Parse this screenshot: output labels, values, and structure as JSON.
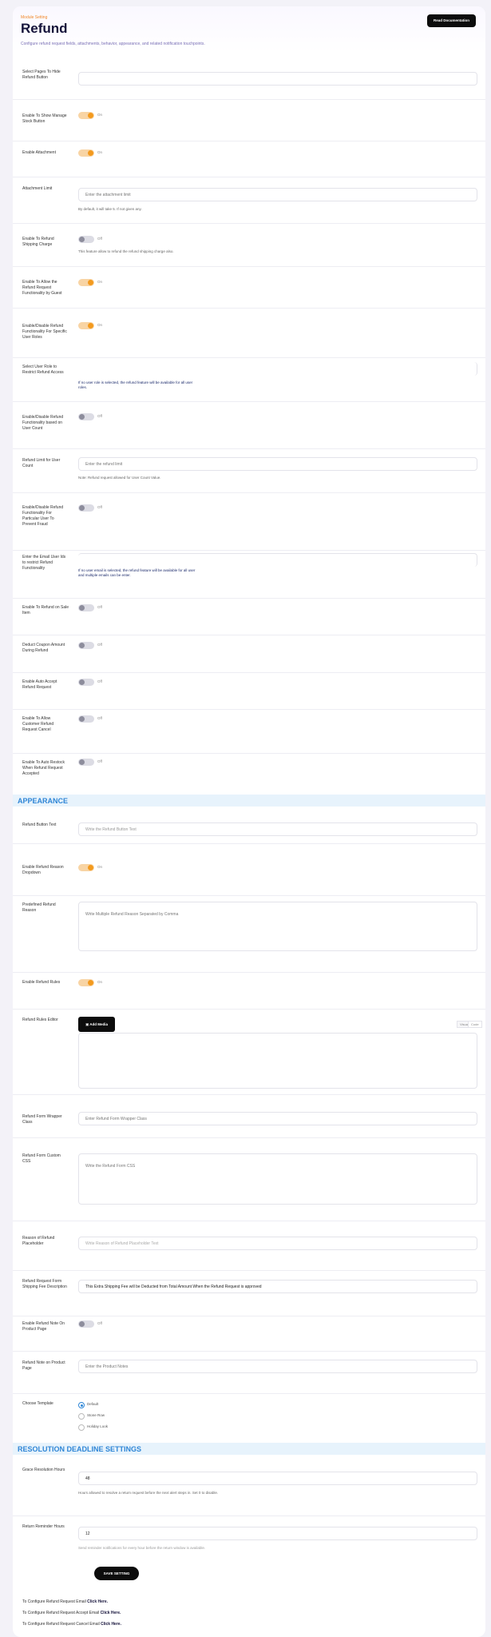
{
  "header": {
    "breadcrumb": "Module Setting",
    "title": "Refund",
    "subtitle": "Configure refund request fields, attachments, behavior, appearance, and related notification touchpoints.",
    "doc_button": "Read Documentation"
  },
  "fields": {
    "select_pages": {
      "label": "Select Pages To Hide Refund Button",
      "value": ""
    },
    "manage_stock": {
      "label": "Enable To Show Manage Stock Button",
      "state": "On"
    },
    "attachment": {
      "label": "Enable Attachment",
      "state": "On"
    },
    "attachment_limit": {
      "label": "Attachment Limit",
      "placeholder": "Enter the attachment limit",
      "desc": "By default, it will take 5. If not given any."
    },
    "shipping_charge": {
      "label": "Enable To Refund Shipping Charge",
      "state": "Off",
      "desc": "This feature allow to refund the refund shipping charge also."
    },
    "guest_user": {
      "label": "Enable To Allow the Refund Request Functionality by Guest",
      "state": "On"
    },
    "specific_user": {
      "label": "Enable/Disable Refund Functionality For Specific User Roles",
      "state": "On"
    },
    "user_roles": {
      "label": "Select User Role to Restrict Refund Access",
      "desc": "If no user role is selected, the refund feature will be available for all user roles."
    },
    "user_count": {
      "label": "Enable/Disable Refund Functionality based on User Count",
      "state": "Off"
    },
    "refund_limit": {
      "label": "Refund Limit for User Count",
      "placeholder": "Enter the refund limit",
      "desc": "Note: Refund request allowed for User Count Value."
    },
    "particular_user": {
      "label": "Enable/Disable Refund Functionality For Particular User To Prevent Fraud",
      "state": "Off"
    },
    "restrict_emails": {
      "label": "Enter the Email User Ids to restrict Refund Functionality",
      "desc": "If no user email is selected, the refund feature will be available for all user and multiple emails can be enter."
    },
    "refund_sale": {
      "label": "Enable To Refund on Sale Item",
      "state": "Off"
    },
    "coupon_amount": {
      "label": "Deduct Coupon Amount During Refund",
      "state": "Off"
    },
    "auto_accept": {
      "label": "Enable Auto Accept Refund Request",
      "state": "Off"
    },
    "customer_cancel": {
      "label": "Enable To Allow Customer Refund Request Cancel",
      "state": "Off"
    },
    "auto_restock": {
      "label": "Enable To Auto Restock When Refund Request Accepted",
      "state": "Off"
    }
  },
  "appearance": {
    "section_title": "APPEARANCE",
    "button_text": {
      "label": "Refund Button Text",
      "placeholder": "Write the Refund Button Text"
    },
    "reasons_toggle": {
      "label": "Enable Refund Reason Dropdown",
      "state": "On"
    },
    "reasons": {
      "label": "Predefined Refund Reason",
      "placeholder": "Write Multiple Refund Reason Separated by Comma"
    },
    "rules_toggle": {
      "label": "Enable Refund Rules",
      "state": "On"
    },
    "rules_editor": {
      "label": "Refund Rules Editor",
      "add_media": "Add Media",
      "tab_visual": "Visual",
      "tab_code": "Code"
    },
    "wrapper_class": {
      "label": "Refund Form Wrapper Class",
      "placeholder": "Enter Refund Form Wrapper Class"
    },
    "custom_css": {
      "label": "Refund Form Custom CSS",
      "placeholder": "Write the Refund Form CSS"
    },
    "reason_placeholder": {
      "label": "Reason of Refund Placeholder",
      "placeholder": "Write Reason of Refund Placeholder Text"
    },
    "shipping_fee_desc": {
      "label": "Refund Request Form Shipping Fee Description",
      "value": "This Extra Shipping Fee will be Deducted from Total Amount When the Refund Request is approved"
    },
    "product_page": {
      "label": "Enable Refund Note On Product Page",
      "state": "Off"
    },
    "product_note": {
      "label": "Refund Note on Product Page",
      "placeholder": "Enter the Product Notes"
    },
    "templates": {
      "label": "Choose Template",
      "options": [
        "Default",
        "Stone Row",
        "Holiday Look"
      ],
      "selected": "Default"
    }
  },
  "deadline": {
    "section_title": "RESOLUTION DEADLINE SETTINGS",
    "grace": {
      "label": "Grace Resolution Hours",
      "value": "48",
      "desc": "Hours allowed to resolve a return request before the next alert steps in. Set 0 to disable."
    },
    "reminder": {
      "label": "Return Reminder Hours",
      "value": "12",
      "desc": "Send reminder notifications for every hour before the return window is available."
    }
  },
  "save_button": "SAVE SETTING",
  "footer": {
    "line1": "To Configure Refund Request Email",
    "line1_link": "Click Here.",
    "line2": "To Configure Refund Request Accept Email",
    "line2_link": "Click Here.",
    "line3": "To Configure Refund Request Cancel Email",
    "line3_link": "Click Here."
  },
  "colors": {
    "accent": "#f39a1e",
    "section": "#2f86d6",
    "title": "#14123a"
  }
}
